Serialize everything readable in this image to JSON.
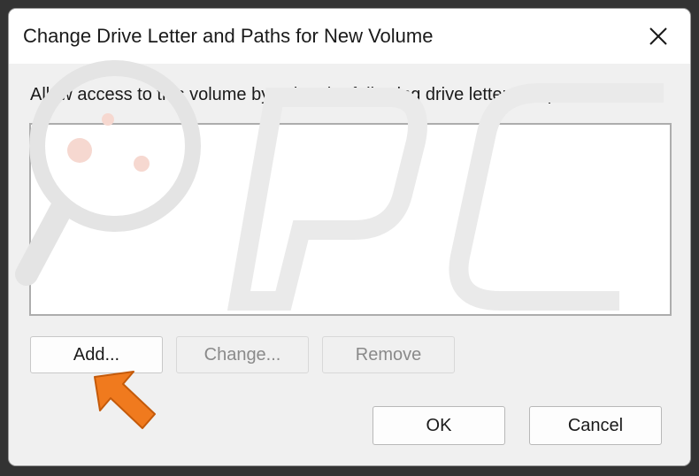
{
  "dialog": {
    "title": "Change Drive Letter and Paths for New Volume",
    "close_icon": "close-icon",
    "instruction": "Allow access to this volume by using the following drive letter and paths:",
    "paths": [],
    "buttons": {
      "add": "Add...",
      "change": "Change...",
      "remove": "Remove",
      "ok": "OK",
      "cancel": "Cancel"
    }
  },
  "colors": {
    "pointer_arrow": "#f07a1e",
    "dialog_bg": "#f0f0f0",
    "titlebar_bg": "#ffffff"
  }
}
